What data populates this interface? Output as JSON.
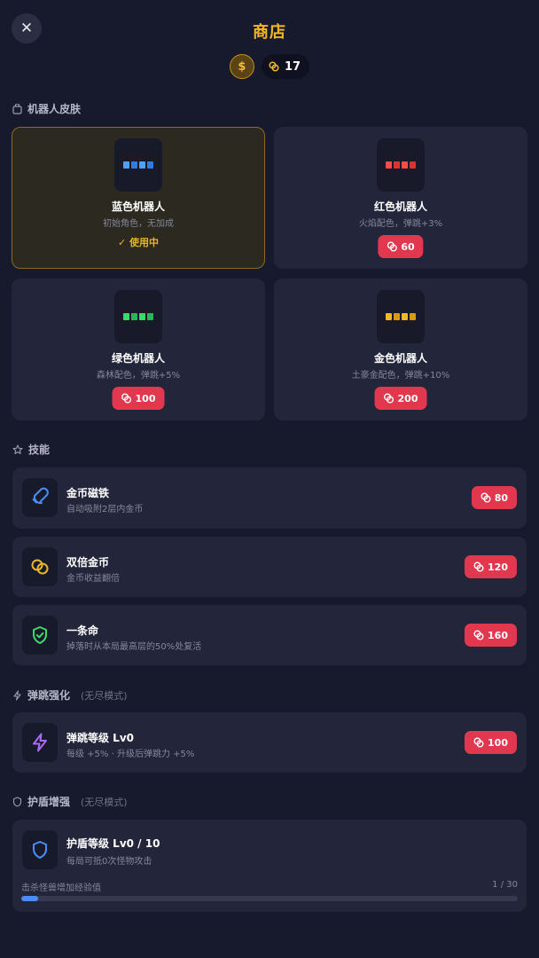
{
  "header": {
    "close_symbol": "✕",
    "title": "商店",
    "dollar_symbol": "$",
    "coin_count": "17"
  },
  "colors": {
    "accent_gold": "#f4b724",
    "price_red": "#e2384f",
    "progress_blue": "#4b8df8",
    "card_bg": "#23263a",
    "page_bg": "#171a2c"
  },
  "skins_section": {
    "title": "机器人皮肤",
    "icon": "bag-icon",
    "cards": [
      {
        "name": "蓝色机器人",
        "desc": "初始角色，无加成",
        "status": "✓ 使用中",
        "sprite_color": "#4aa3ff",
        "icon": "blue-robot-sprite-icon"
      },
      {
        "name": "红色机器人",
        "desc": "火焰配色，弹跳+3%",
        "price": "60",
        "sprite_color": "#ff4a4a",
        "icon": "red-robot-sprite-icon"
      },
      {
        "name": "绿色机器人",
        "desc": "森林配色，弹跳+5%",
        "price": "100",
        "sprite_color": "#3ed86a",
        "icon": "green-robot-sprite-icon"
      },
      {
        "name": "金色机器人",
        "desc": "土豪金配色，弹跳+10%",
        "price": "200",
        "sprite_color": "#f2b62a",
        "icon": "gold-robot-sprite-icon"
      }
    ]
  },
  "skills_section": {
    "title": "技能",
    "icon": "star-icon",
    "items": [
      {
        "name": "金币磁铁",
        "desc": "自动吸附2层内金币",
        "price": "80",
        "icon": "magnet-icon"
      },
      {
        "name": "双倍金币",
        "desc": "金币收益翻倍",
        "price": "120",
        "icon": "double-coin-icon"
      },
      {
        "name": "一条命",
        "desc": "掉落时从本局最高层的50%处复活",
        "price": "160",
        "icon": "shield-check-icon"
      }
    ]
  },
  "jump_section": {
    "title": "弹跳强化",
    "subtitle": "(无尽模式)",
    "icon": "lightning-icon",
    "item": {
      "name": "弹跳等级 Lv0",
      "desc": "每级 +5% · 升级后弹跳力 +5%",
      "price": "100",
      "icon": "lightning-icon"
    }
  },
  "shield_section": {
    "title": "护盾增强",
    "subtitle": "(无尽模式)",
    "icon": "shield-icon",
    "item": {
      "name": "护盾等级 Lv0 / 10",
      "desc": "每局可抵0次怪物攻击",
      "icon": "shield-icon",
      "progress_label": "击杀怪兽增加经验值",
      "progress_text": "1 / 30",
      "progress_value": 1,
      "progress_max": 30
    }
  }
}
